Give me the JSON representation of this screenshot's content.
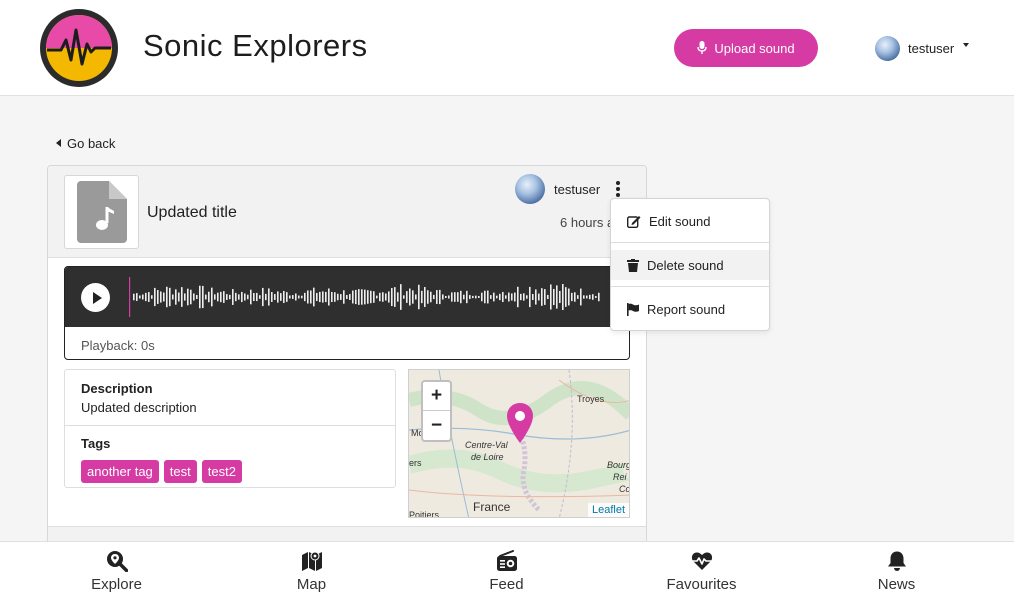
{
  "app": {
    "brand": "Sonic Explorers",
    "accent": "#d63ba4"
  },
  "header": {
    "upload_label": "Upload sound",
    "username": "testuser"
  },
  "nav": {
    "go_back": "Go back"
  },
  "sound": {
    "title": "Updated title",
    "owner": "testuser",
    "time": "6 hours ago",
    "playback": "Playback: 0s",
    "description_label": "Description",
    "description": "Updated description",
    "tags_label": "Tags",
    "tags": [
      "another tag",
      "test",
      "test2"
    ]
  },
  "map": {
    "labels": [
      "Troyes",
      "Centre-Val",
      "de Loire",
      "France",
      "Bourg",
      "Rei",
      "Co",
      "Poitiers",
      "Mo",
      "ers"
    ],
    "zoom_in": "+",
    "zoom_out": "−",
    "attribution": "Leaflet"
  },
  "menu": {
    "items": [
      {
        "label": "Edit sound",
        "icon": "edit-icon"
      },
      {
        "label": "Delete sound",
        "icon": "trash-icon"
      },
      {
        "label": "Report sound",
        "icon": "flag-icon"
      }
    ]
  },
  "bottom_nav": [
    {
      "label": "Explore",
      "icon": "search-location-icon"
    },
    {
      "label": "Map",
      "icon": "map-icon"
    },
    {
      "label": "Feed",
      "icon": "radio-icon"
    },
    {
      "label": "Favourites",
      "icon": "heart-pulse-icon"
    },
    {
      "label": "News",
      "icon": "bell-icon"
    }
  ]
}
